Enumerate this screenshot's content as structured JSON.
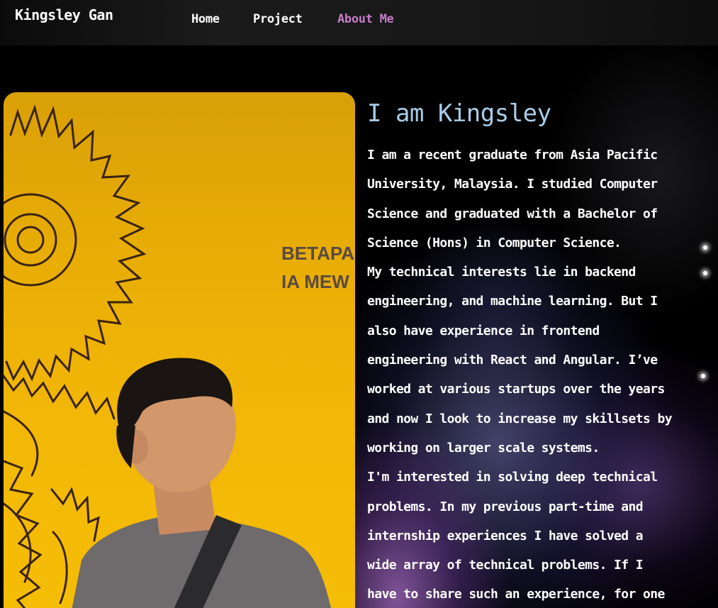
{
  "nav": {
    "brand": "Kingsley Gan",
    "links": [
      {
        "label": "Home",
        "active": false
      },
      {
        "label": "Project",
        "active": false
      },
      {
        "label": "About Me",
        "active": true
      }
    ],
    "active_color": "#c67ac7"
  },
  "about": {
    "heading": "I am Kingsley",
    "heading_color": "#a9cde8",
    "lines": [
      "I am a recent graduate from Asia Pacific",
      "University, Malaysia. I studied Computer",
      "Science and graduated with a Bachelor of",
      "Science (Hons) in Computer Science.",
      "My technical interests lie in backend",
      "engineering, and machine learning. But I",
      "also have experience in frontend",
      "engineering with React and Angular. I’ve",
      "worked at various startups over the years",
      "and now I look to increase my skillsets by",
      "working on larger scale systems.",
      "I'm interested in solving deep technical",
      "problems. In my previous part-time and",
      "internship experiences I have solved a",
      "wide array of technical problems. If I",
      "have to share such an experience, for one"
    ]
  },
  "photo": {
    "wall_text_line1": "BETAPA",
    "wall_text_line2": "IA MEW",
    "background_color": "#f2b707"
  }
}
